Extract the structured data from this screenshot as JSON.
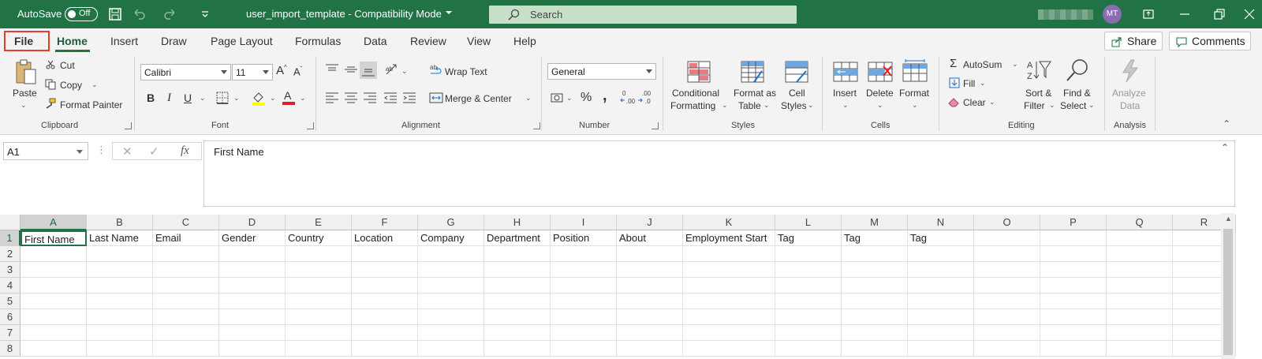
{
  "titlebar": {
    "autosave_label": "AutoSave",
    "autosave_state": "Off",
    "document_title": "user_import_template  -  Compatibility Mode",
    "search_placeholder": "Search",
    "user_initials": "MT"
  },
  "tabs": [
    "File",
    "Home",
    "Insert",
    "Draw",
    "Page Layout",
    "Formulas",
    "Data",
    "Review",
    "View",
    "Help"
  ],
  "actions": {
    "share": "Share",
    "comments": "Comments"
  },
  "ribbon": {
    "clipboard": {
      "paste": "Paste",
      "cut": "Cut",
      "copy": "Copy",
      "format_painter": "Format Painter",
      "label": "Clipboard"
    },
    "font": {
      "name": "Calibri",
      "size": "11",
      "bold": "B",
      "italic": "I",
      "underline": "U",
      "label": "Font"
    },
    "alignment": {
      "wrap_text": "Wrap Text",
      "merge_center": "Merge & Center",
      "label": "Alignment"
    },
    "number": {
      "format": "General",
      "percent": "%",
      "comma": ",",
      "label": "Number"
    },
    "styles": {
      "conditional_1": "Conditional",
      "conditional_2": "Formatting",
      "format_table_1": "Format as",
      "format_table_2": "Table",
      "cell_styles_1": "Cell",
      "cell_styles_2": "Styles",
      "label": "Styles"
    },
    "cells": {
      "insert": "Insert",
      "delete": "Delete",
      "format": "Format",
      "label": "Cells"
    },
    "editing": {
      "autosum": "AutoSum",
      "fill": "Fill",
      "clear": "Clear",
      "sort_1": "Sort &",
      "sort_2": "Filter",
      "find_1": "Find &",
      "find_2": "Select",
      "label": "Editing"
    },
    "analysis": {
      "analyze_1": "Analyze",
      "analyze_2": "Data",
      "label": "Analysis"
    }
  },
  "formula_bar": {
    "name_box": "A1",
    "fx": "fx",
    "content": "First Name"
  },
  "sheet": {
    "columns": [
      "A",
      "B",
      "C",
      "D",
      "E",
      "F",
      "G",
      "H",
      "I",
      "J",
      "K",
      "L",
      "M",
      "N",
      "O",
      "P",
      "Q",
      "R"
    ],
    "rows": [
      "1",
      "2",
      "3",
      "4",
      "5",
      "6",
      "7",
      "8"
    ],
    "row1": [
      "First Name",
      "Last Name",
      "Email",
      "Gender",
      "Country",
      "Location",
      "Company",
      "Department",
      "Position",
      "About",
      "Employment Start",
      "Tag",
      "Tag",
      "Tag",
      "",
      "",
      "",
      ""
    ]
  },
  "colors": {
    "accent": "#217346",
    "file_highlight": "#e0402a"
  }
}
